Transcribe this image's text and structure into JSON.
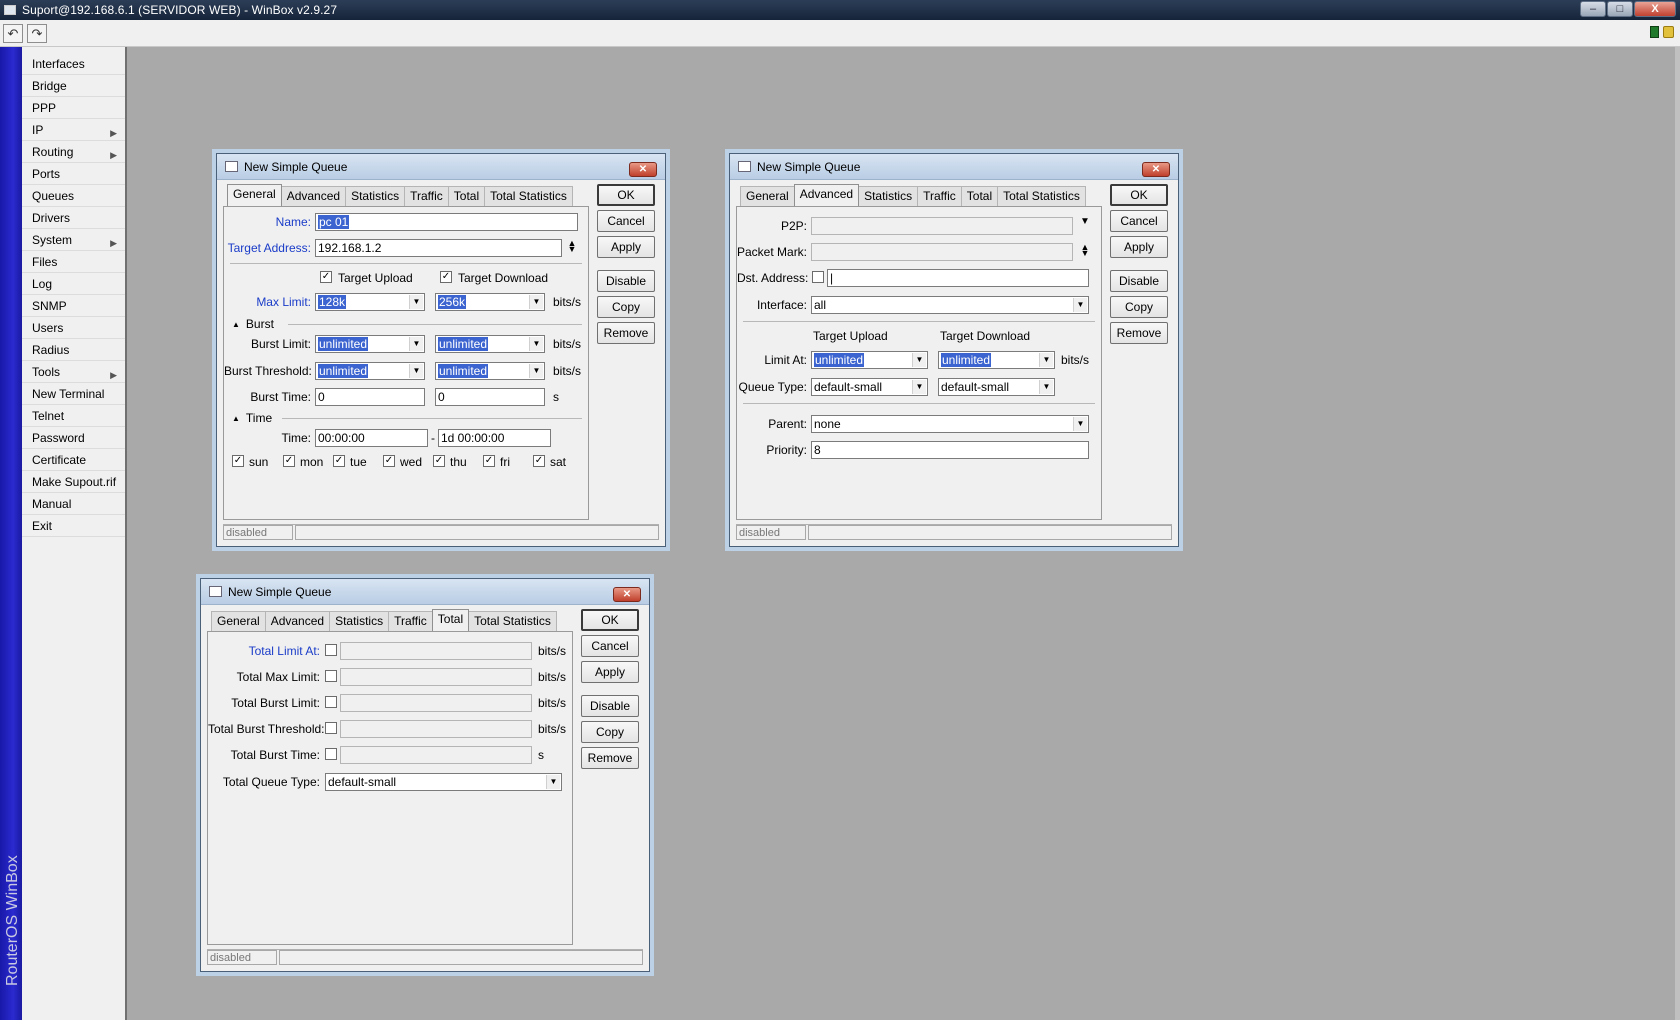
{
  "window": {
    "title": "Suport@192.168.6.1 (SERVIDOR WEB) - WinBox v2.9.27",
    "minimize": "–",
    "maximize": "□",
    "close": "X"
  },
  "toolbar": {
    "undo": "↶",
    "redo": "↷"
  },
  "brand": "RouterOS WinBox",
  "menu": {
    "items": [
      {
        "label": "Interfaces",
        "arrow": ""
      },
      {
        "label": "Bridge",
        "arrow": ""
      },
      {
        "label": "PPP",
        "arrow": ""
      },
      {
        "label": "IP",
        "arrow": "▶"
      },
      {
        "label": "Routing",
        "arrow": "▶"
      },
      {
        "label": "Ports",
        "arrow": ""
      },
      {
        "label": "Queues",
        "arrow": ""
      },
      {
        "label": "Drivers",
        "arrow": ""
      },
      {
        "label": "System",
        "arrow": "▶"
      },
      {
        "label": "Files",
        "arrow": ""
      },
      {
        "label": "Log",
        "arrow": ""
      },
      {
        "label": "SNMP",
        "arrow": ""
      },
      {
        "label": "Users",
        "arrow": ""
      },
      {
        "label": "Radius",
        "arrow": ""
      },
      {
        "label": "Tools",
        "arrow": "▶"
      },
      {
        "label": "New Terminal",
        "arrow": ""
      },
      {
        "label": "Telnet",
        "arrow": ""
      },
      {
        "label": "Password",
        "arrow": ""
      },
      {
        "label": "Certificate",
        "arrow": ""
      },
      {
        "label": "Make Supout.rif",
        "arrow": ""
      },
      {
        "label": "Manual",
        "arrow": ""
      },
      {
        "label": "Exit",
        "arrow": ""
      }
    ]
  },
  "buttons": {
    "ok": "OK",
    "cancel": "Cancel",
    "apply": "Apply",
    "disable": "Disable",
    "copy": "Copy",
    "remove": "Remove"
  },
  "status": "disabled",
  "dialog_title": "New Simple Queue",
  "tabs": [
    "General",
    "Advanced",
    "Statistics",
    "Traffic",
    "Total",
    "Total Statistics"
  ],
  "d1": {
    "name_label": "Name:",
    "name": "pc 01",
    "target_label": "Target Address:",
    "target": "192.168.1.2",
    "target_upload": "Target Upload",
    "target_download": "Target Download",
    "max_limit_label": "Max Limit:",
    "max_up": "128k",
    "max_down": "256k",
    "unit_bits": "bits/s",
    "unit_s": "s",
    "burst_section": "Burst",
    "burst_limit_label": "Burst Limit:",
    "burst_limit_up": "unlimited",
    "burst_limit_down": "unlimited",
    "burst_threshold_label": "Burst Threshold:",
    "burst_threshold_up": "unlimited",
    "burst_threshold_down": "unlimited",
    "burst_time_label": "Burst Time:",
    "burst_time_up": "0",
    "burst_time_down": "0",
    "time_section": "Time",
    "time_label": "Time:",
    "time_from": "00:00:00",
    "time_dash": "-",
    "time_to": "1d 00:00:00",
    "days": [
      "sun",
      "mon",
      "tue",
      "wed",
      "thu",
      "fri",
      "sat"
    ]
  },
  "d2": {
    "p2p_label": "P2P:",
    "packet_mark_label": "Packet Mark:",
    "dst_label": "Dst. Address:",
    "interface_label": "Interface:",
    "interface": "all",
    "target_upload": "Target Upload",
    "target_download": "Target Download",
    "limit_at_label": "Limit At:",
    "limit_up": "unlimited",
    "limit_down": "unlimited",
    "queue_type_label": "Queue Type:",
    "queue_up": "default-small",
    "queue_down": "default-small",
    "parent_label": "Parent:",
    "parent": "none",
    "priority_label": "Priority:",
    "priority": "8",
    "unit_bits": "bits/s"
  },
  "d3": {
    "total_limit_at_label": "Total Limit At:",
    "total_max_limit_label": "Total Max Limit:",
    "total_burst_limit_label": "Total Burst Limit:",
    "total_burst_threshold_label": "Total Burst Threshold:",
    "total_burst_time_label": "Total Burst Time:",
    "total_queue_type_label": "Total Queue Type:",
    "total_queue_type": "default-small",
    "unit_bits": "bits/s",
    "unit_s": "s"
  }
}
